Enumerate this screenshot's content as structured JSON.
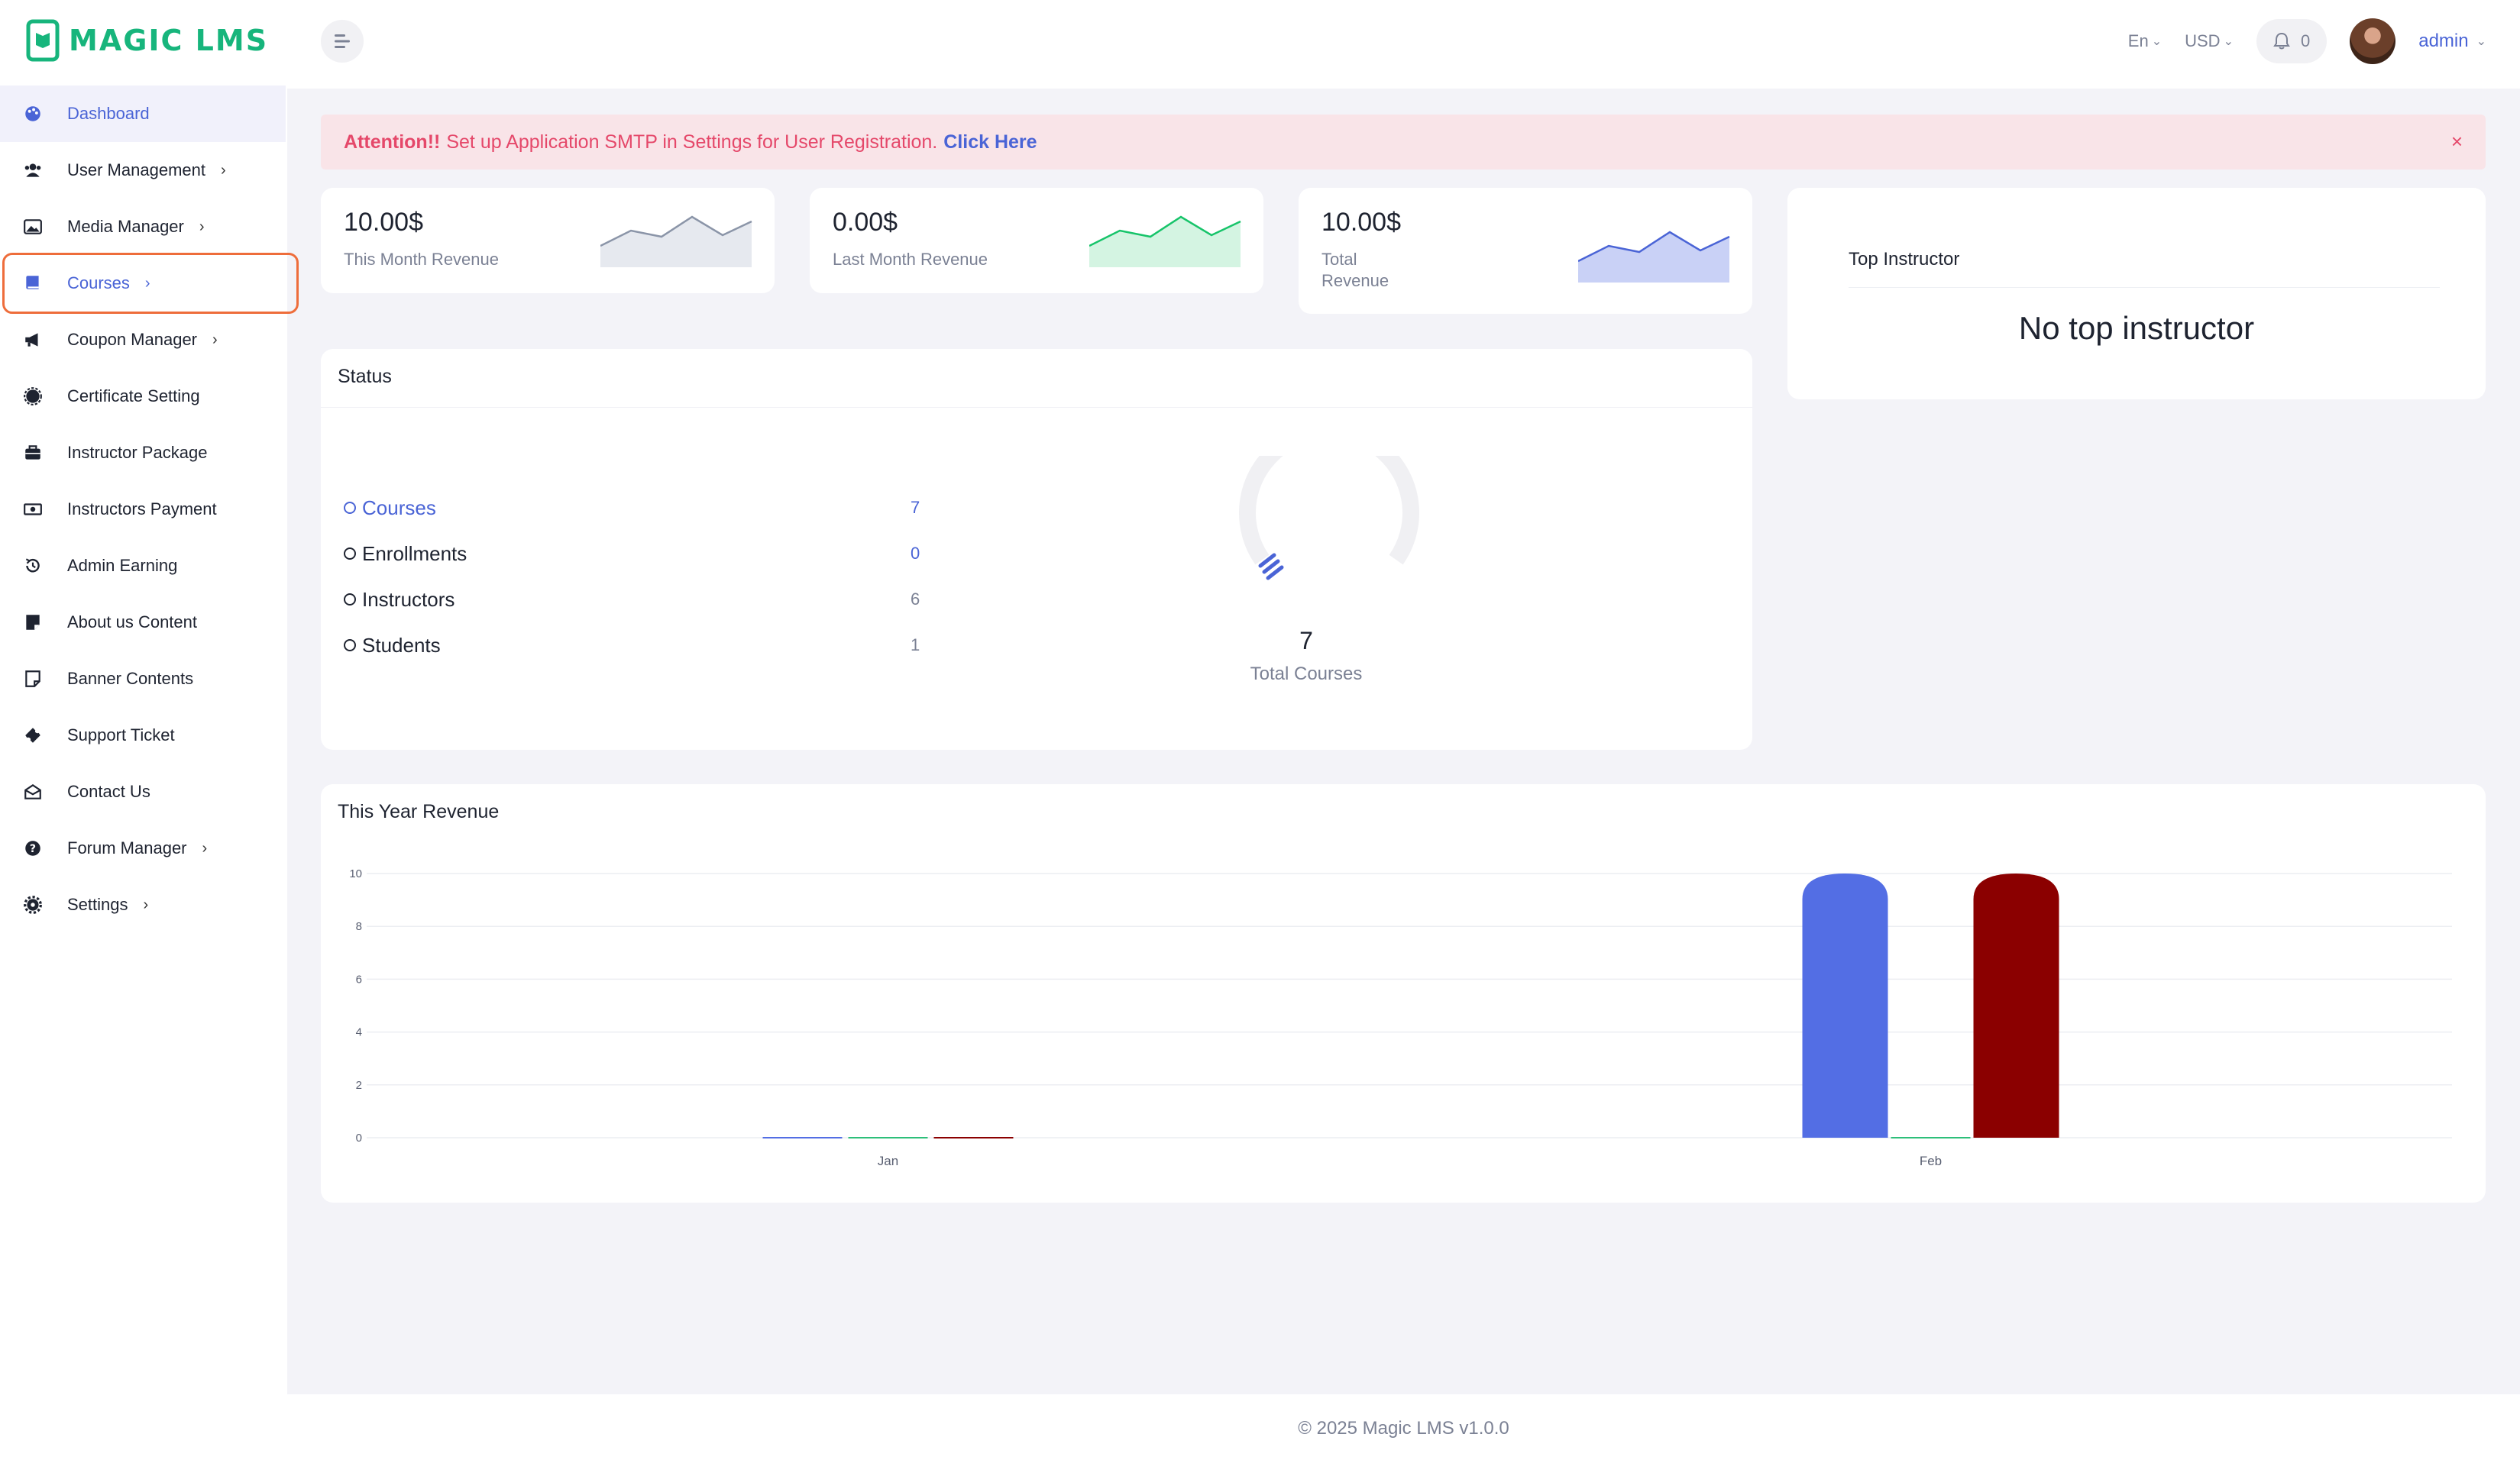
{
  "brand": {
    "name": "MAGIC LMS",
    "color": "#17b57c"
  },
  "sidebar": {
    "items": [
      {
        "label": "Dashboard",
        "icon": "palette-icon",
        "chevron": false,
        "state": "active"
      },
      {
        "label": "User Management",
        "icon": "users-icon",
        "chevron": true
      },
      {
        "label": "Media Manager",
        "icon": "image-icon",
        "chevron": true
      },
      {
        "label": "Courses",
        "icon": "book-icon",
        "chevron": true,
        "state": "highlighted"
      },
      {
        "label": "Coupon Manager",
        "icon": "megaphone-icon",
        "chevron": true
      },
      {
        "label": "Certificate Setting",
        "icon": "badge-icon",
        "chevron": false
      },
      {
        "label": "Instructor Package",
        "icon": "briefcase-icon",
        "chevron": false
      },
      {
        "label": "Instructors Payment",
        "icon": "money-icon",
        "chevron": false
      },
      {
        "label": "Admin Earning",
        "icon": "history-icon",
        "chevron": false
      },
      {
        "label": "About us Content",
        "icon": "note-icon",
        "chevron": false
      },
      {
        "label": "Banner Contents",
        "icon": "sticky-note-icon",
        "chevron": false
      },
      {
        "label": "Support Ticket",
        "icon": "ticket-icon",
        "chevron": false
      },
      {
        "label": "Contact Us",
        "icon": "envelope-open-icon",
        "chevron": false
      },
      {
        "label": "Forum Manager",
        "icon": "question-circle-icon",
        "chevron": true
      },
      {
        "label": "Settings",
        "icon": "gear-icon",
        "chevron": true
      }
    ]
  },
  "topbar": {
    "language": "En",
    "currency": "USD",
    "notifications_count": "0",
    "user_name": "admin"
  },
  "alert": {
    "prefix": "Attention!!",
    "message": "Set up Application SMTP in Settings for User Registration.",
    "link": "Click Here",
    "close": "×"
  },
  "revenue_cards": [
    {
      "amount": "10.00$",
      "label": "This Month Revenue",
      "color": "#8b95a8"
    },
    {
      "amount": "0.00$",
      "label": "Last Month Revenue",
      "color": "#17c46a"
    },
    {
      "amount": "10.00$",
      "label": "Total Revenue",
      "color": "#4a64d6"
    }
  ],
  "top_instructor": {
    "title": "Top Instructor",
    "empty": "No top instructor"
  },
  "status": {
    "title": "Status",
    "rows": [
      {
        "label": "Courses",
        "value": "7"
      },
      {
        "label": "Enrollments",
        "value": "0"
      },
      {
        "label": "Instructors",
        "value": "6"
      },
      {
        "label": "Students",
        "value": "1"
      }
    ],
    "total_value": "7",
    "total_label": "Total Courses"
  },
  "year_revenue": {
    "title": "This Year Revenue"
  },
  "chart_data": {
    "type": "bar",
    "categories": [
      "Jan",
      "Feb"
    ],
    "series": [
      {
        "values": [
          0,
          10
        ],
        "color": "#536ee4"
      },
      {
        "values": [
          0,
          0
        ],
        "color": "#2dbf7a"
      },
      {
        "values": [
          0,
          10
        ],
        "color": "#8b0000"
      }
    ],
    "yticks": [
      0,
      2,
      4,
      6,
      8,
      10
    ],
    "ylim": [
      0,
      10
    ],
    "grid": true
  },
  "footer": {
    "text": "© 2025 Magic LMS v1.0.0"
  }
}
